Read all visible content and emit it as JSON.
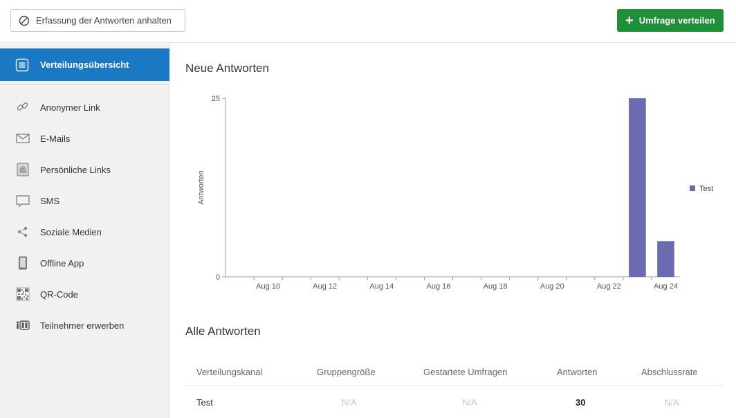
{
  "toolbar": {
    "pause_label": "Erfassung der Antworten anhalten",
    "share_label": "Umfrage verteilen",
    "share_color": "#1f8f3a"
  },
  "sidebar": {
    "active": {
      "label": "Verteilungsübersicht",
      "icon": "list-icon",
      "color": "#1b78c2"
    },
    "items": [
      {
        "label": "Anonymer Link",
        "icon": "link-icon"
      },
      {
        "label": "E-Mails",
        "icon": "envelope-icon"
      },
      {
        "label": "Persönliche Links",
        "icon": "fingerprint-icon"
      },
      {
        "label": "SMS",
        "icon": "message-icon"
      },
      {
        "label": "Soziale Medien",
        "icon": "share-icon"
      },
      {
        "label": "Offline App",
        "icon": "tablet-icon"
      },
      {
        "label": "QR-Code",
        "icon": "qr-code-icon"
      },
      {
        "label": "Teilnehmer erwerben",
        "icon": "people-icon"
      }
    ]
  },
  "main": {
    "new_responses_title": "Neue Antworten",
    "all_responses_title": "Alle Antworten"
  },
  "chart_data": {
    "type": "bar",
    "title": "Neue Antworten",
    "ylabel": "Antworten",
    "xlabel": "",
    "ylim": [
      0,
      25
    ],
    "yticks": [
      0,
      25
    ],
    "x_tick_labels": [
      "Aug 10",
      "Aug 12",
      "Aug 14",
      "Aug 16",
      "Aug 18",
      "Aug 20",
      "Aug 22",
      "Aug 24"
    ],
    "categories": [
      "Aug 9",
      "Aug 10",
      "Aug 11",
      "Aug 12",
      "Aug 13",
      "Aug 14",
      "Aug 15",
      "Aug 16",
      "Aug 17",
      "Aug 18",
      "Aug 19",
      "Aug 20",
      "Aug 21",
      "Aug 22",
      "Aug 23",
      "Aug 24"
    ],
    "series": [
      {
        "name": "Test",
        "color": "#6b6bb3",
        "values": [
          0,
          0,
          0,
          0,
          0,
          0,
          0,
          0,
          0,
          0,
          0,
          0,
          0,
          0,
          25,
          5
        ]
      }
    ],
    "legend": "right",
    "grid": false
  },
  "table": {
    "columns": [
      "Verteilungskanal",
      "Gruppengröße",
      "Gestartete Umfragen",
      "Antworten",
      "Abschlussrate"
    ],
    "rows": [
      [
        "Test",
        "N/A",
        "N/A",
        "30",
        "N/A"
      ]
    ]
  }
}
